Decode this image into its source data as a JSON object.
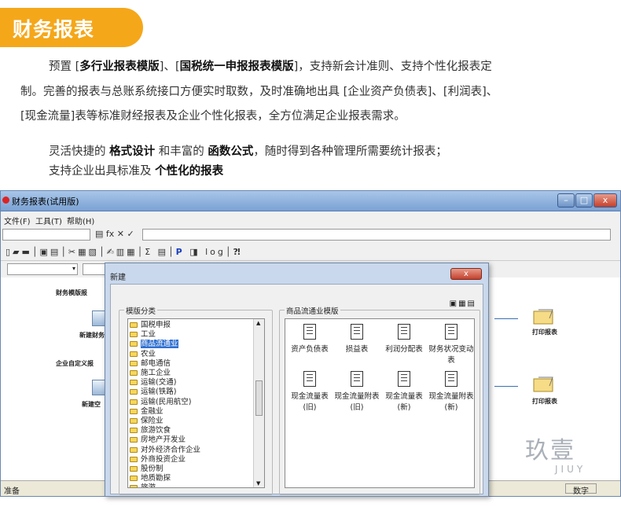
{
  "section_badge": "财务报表",
  "intro": {
    "l1_a": "预置 [",
    "l1_b": "多行业报表模版",
    "l1_c": "]、[",
    "l1_d": "国税统一申报报表模版",
    "l1_e": "]，支持新会计准则、支持个性化报表定",
    "l2": "制。完善的报表与总账系统接口方便实时取数，及时准确地出具 [企业资产负债表]、[利润表]、",
    "l3": "[现金流量]表等标准财经报表及企业个性化报表，全方位满足企业报表需求。"
  },
  "feature": {
    "a": "灵活快捷的 ",
    "b": "格式设计",
    "c": " 和丰富的 ",
    "d": "函数公式",
    "e": "，随时得到各种管理所需要统计报表；",
    "f": "支持企业出具标准及 ",
    "g": "个性化的报表"
  },
  "window": {
    "title": "财务报表(试用版)",
    "menu": [
      "文件(F)",
      "工具(T)",
      "帮助(H)"
    ],
    "status_left": "准备",
    "status_right": "数字"
  },
  "canvas": {
    "heading1": "财务模版报",
    "heading2": "企业自定义报",
    "node1": "新建财务",
    "node2": "新建空",
    "print1": "打印报表",
    "print2": "打印报表"
  },
  "dialog": {
    "title": "新建",
    "close": "x",
    "group_left": "模版分类",
    "group_right": "商品流通业模版",
    "categories": [
      "国税申报",
      "工业",
      "商品流通业",
      "农业",
      "邮电通信",
      "施工企业",
      "运输(交通)",
      "运输(铁路)",
      "运输(民用航空)",
      "金融业",
      "保险业",
      "旅游饮食",
      "房地产开发业",
      "对外经济合作企业",
      "外商投资企业",
      "股份制",
      "地质勘探",
      "旅游"
    ],
    "selected_category": "商品流通业",
    "templates": [
      "资产负债表",
      "损益表",
      "利润分配表",
      "财务状况变动表",
      "现金流量表(旧)",
      "现金流量附表(旧)",
      "现金流量表(新)",
      "现金流量附表(新)"
    ]
  },
  "watermark": {
    "cn": "玖壹",
    "en": "JIUY"
  }
}
